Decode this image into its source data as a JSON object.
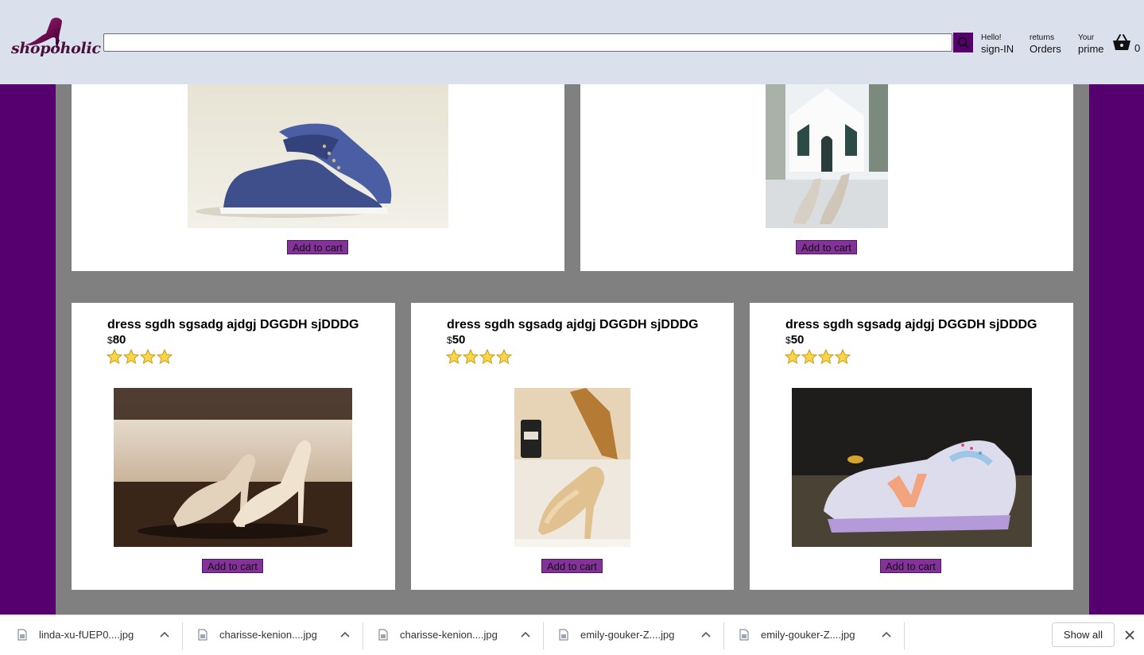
{
  "header": {
    "logo_text": "shopoholic",
    "search_placeholder": "",
    "nav": [
      {
        "line1": "Hello!",
        "line2": "sign-IN"
      },
      {
        "line1": "returns",
        "line2": "Orders"
      },
      {
        "line1": "Your",
        "line2": "prime"
      }
    ],
    "basket_count": "0"
  },
  "top_products": [
    {
      "image": "blue-canvas-sneakers",
      "button": "Add to cart"
    },
    {
      "image": "glitter-heels-chapel",
      "button": "Add to cart"
    }
  ],
  "products": [
    {
      "title": "dress sgdh sgsadg ajdgj DGGDH sjDDDG",
      "currency": "$",
      "price": "80",
      "rating": 4,
      "image": "nude-pumps",
      "button": "Add to cart"
    },
    {
      "title": "dress sgdh sgsadg ajdgj DGGDH sjDDDG",
      "currency": "$",
      "price": "50",
      "rating": 4,
      "image": "glitter-gold-heels",
      "button": "Add to cart"
    },
    {
      "title": "dress sgdh sgsadg ajdgj DGGDH sjDDDG",
      "currency": "$",
      "price": "50",
      "rating": 4,
      "image": "new-balance-sneakers",
      "button": "Add to cart"
    }
  ],
  "downloads": {
    "items": [
      {
        "name": "linda-xu-fUEP0....jpg"
      },
      {
        "name": "charisse-kenion....jpg"
      },
      {
        "name": "charisse-kenion....jpg"
      },
      {
        "name": "emily-gouker-Z....jpg"
      },
      {
        "name": "emily-gouker-Z....jpg"
      }
    ],
    "show_all": "Show all"
  },
  "colors": {
    "brand_purple": "#55006e",
    "button_purple": "#84329a",
    "header_bg": "#dae1ec",
    "content_gray": "#808080"
  }
}
